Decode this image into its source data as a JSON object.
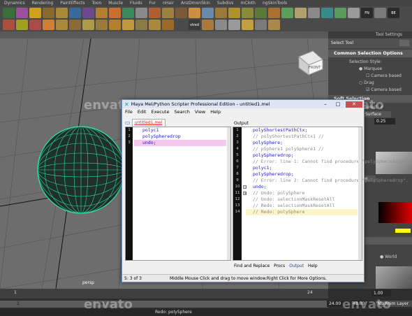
{
  "shelf_tabs": [
    "Dynamics",
    "Rendering",
    "PaintEffects",
    "Toon",
    "Muscle",
    "Fluids",
    "Fur",
    "nHair",
    "AnzDmonSkin",
    "Subdivs",
    "mCloth",
    "ngSkinTools"
  ],
  "shelf_icons": [
    {
      "label": "",
      "color": "#3a6e3a"
    },
    {
      "label": "",
      "color": "#9c4f9c"
    },
    {
      "label": "",
      "color": "#d0a020"
    },
    {
      "label": "",
      "color": "#8a6a2a"
    },
    {
      "label": "",
      "color": "#aa8a3a"
    },
    {
      "label": "",
      "color": "#3a6a9a"
    },
    {
      "label": "",
      "color": "#6a4a8a"
    },
    {
      "label": "",
      "color": "#b08030"
    },
    {
      "label": "",
      "color": "#c87030"
    },
    {
      "label": "",
      "color": "#3a8a5a"
    },
    {
      "label": "",
      "color": "#8a8a8a"
    },
    {
      "label": "",
      "color": "#b06030"
    },
    {
      "label": "",
      "color": "#a08040"
    },
    {
      "label": "",
      "color": "#7a5a3a"
    },
    {
      "label": "",
      "color": "#cc9040"
    },
    {
      "label": "",
      "color": "#6a8aaa"
    },
    {
      "label": "",
      "color": "#9a7a3a"
    },
    {
      "label": "",
      "color": "#b0902a"
    },
    {
      "label": "",
      "color": "#8a8a3a"
    },
    {
      "label": "",
      "color": "#5a7a3a"
    },
    {
      "label": "",
      "color": "#aa7030"
    },
    {
      "label": "",
      "color": "#5aa05a"
    },
    {
      "label": "",
      "color": "#b0a070"
    },
    {
      "label": "",
      "color": "#8a8a8a"
    },
    {
      "label": "",
      "color": "#3a8a8a"
    },
    {
      "label": "",
      "color": "#5a9a5a"
    },
    {
      "label": "",
      "color": "#9a9a9a"
    },
    {
      "label": "FN",
      "color": "#2a2a2a"
    },
    {
      "label": "",
      "color": "#7a7a7a"
    },
    {
      "label": "BE",
      "color": "#2a2a2a"
    },
    {
      "label": "",
      "color": "#aa5040"
    },
    {
      "label": "",
      "color": "#a0a020"
    },
    {
      "label": "",
      "color": "#aa4a4a"
    },
    {
      "label": "",
      "color": "#d08030"
    },
    {
      "label": "",
      "color": "#aa8a3a"
    },
    {
      "label": "",
      "color": "#8a6a3a"
    },
    {
      "label": "",
      "color": "#aa9a4a"
    },
    {
      "label": "",
      "color": "#9a7a3a"
    },
    {
      "label": "",
      "color": "#b0802a"
    },
    {
      "label": "",
      "color": "#c09a3a"
    },
    {
      "label": "",
      "color": "#8a7a4a"
    },
    {
      "label": "",
      "color": "#aa8a3a"
    },
    {
      "label": "",
      "color": "#9a6a2a"
    },
    {
      "label": "",
      "color": "#4a4a4a"
    },
    {
      "label": "vtred",
      "color": "#3a3a3a"
    },
    {
      "label": "",
      "color": "#aa7a3a"
    },
    {
      "label": "",
      "color": "#8a8a8a"
    },
    {
      "label": "",
      "color": "#9a9a9a"
    },
    {
      "label": "",
      "color": "#c0a040"
    },
    {
      "label": "",
      "color": "#7a7a7a"
    },
    {
      "label": "",
      "color": "#aa8a4a"
    }
  ],
  "viewport": {
    "camera_label": "persp",
    "view_cube_label": "FRONT"
  },
  "panel": {
    "header": "Tool Settings",
    "tool_title": "Select Tool",
    "sections": {
      "common": "Common Selection Options",
      "soft": "Soft Selection"
    },
    "rows": {
      "selection_style": "Selection Style:",
      "marquee": "Marquee",
      "camera_based": "Camera based",
      "drag": "Drag",
      "camera_based_2": "Camera based",
      "soft_select": "Soft Select:",
      "mode_value": "Surface",
      "falloff_value": "0.25",
      "none_value": "None",
      "settings": "ettings",
      "world": "World"
    }
  },
  "timeline": {
    "ticks": [
      "1",
      "",
      "",
      "",
      "",
      "",
      "",
      "",
      "",
      "",
      "",
      "24"
    ],
    "start": "1.00",
    "range_start": "1",
    "range_end": "24",
    "end": "24.00",
    "max": "48.00",
    "anim_layer": "No Anim Layer",
    "cmd_result": "Redo: polySphere"
  },
  "dialog": {
    "title": "Maya Mel/Python Scripter Professional Edition - untitled1.mel",
    "menu": [
      "File",
      "Edit",
      "Execute",
      "Search",
      "View",
      "Help"
    ],
    "tab_label": "untitled1.mel",
    "output_label": "Output",
    "editor_lines": [
      "polyc1",
      "polySpheredrop",
      "undo;"
    ],
    "editor_line_numbers": [
      "1",
      "2",
      "3"
    ],
    "output_lines": [
      {
        "text": "polyShortestPathCtx;",
        "kind": "code"
      },
      {
        "text": "// polyShortestPathCtx1 //",
        "kind": "comment"
      },
      {
        "text": "polySphere;",
        "kind": "code"
      },
      {
        "text": "// pSphere1 polySphere1 //",
        "kind": "comment"
      },
      {
        "text": "polySpheredrop;",
        "kind": "code"
      },
      {
        "text": "// Error: line 1: Cannot find procedure \"polySpheredrop\".",
        "kind": "comment"
      },
      {
        "text": "polyc1;",
        "kind": "code"
      },
      {
        "text": "polySpheredrop;",
        "kind": "code"
      },
      {
        "text": "// Error: line 2: Cannot find procedure \"polySpheredrop\".",
        "kind": "comment"
      },
      {
        "text": "undo;",
        "kind": "code"
      },
      {
        "text": "// Undo: polySphere",
        "kind": "comment"
      },
      {
        "text": "// Undo: selectionMaskResetAll",
        "kind": "comment"
      },
      {
        "text": "// Redo: selectionMaskResetAll",
        "kind": "comment"
      },
      {
        "text": "// Redo: polySphere",
        "kind": "comment-hl"
      }
    ],
    "output_line_numbers": [
      "1",
      "2",
      "3",
      "4",
      "5",
      "6",
      "7",
      "8",
      "9",
      "10",
      "11",
      "12",
      "13",
      "14"
    ],
    "bottom_tabs": [
      "Find and Replace",
      "Procs",
      "Output",
      "Help"
    ],
    "status_pos": "5: 3 of 3",
    "status_msg": "Middle Mouse Click and drag to move window.Right Click for More Options."
  },
  "watermark": "envato"
}
